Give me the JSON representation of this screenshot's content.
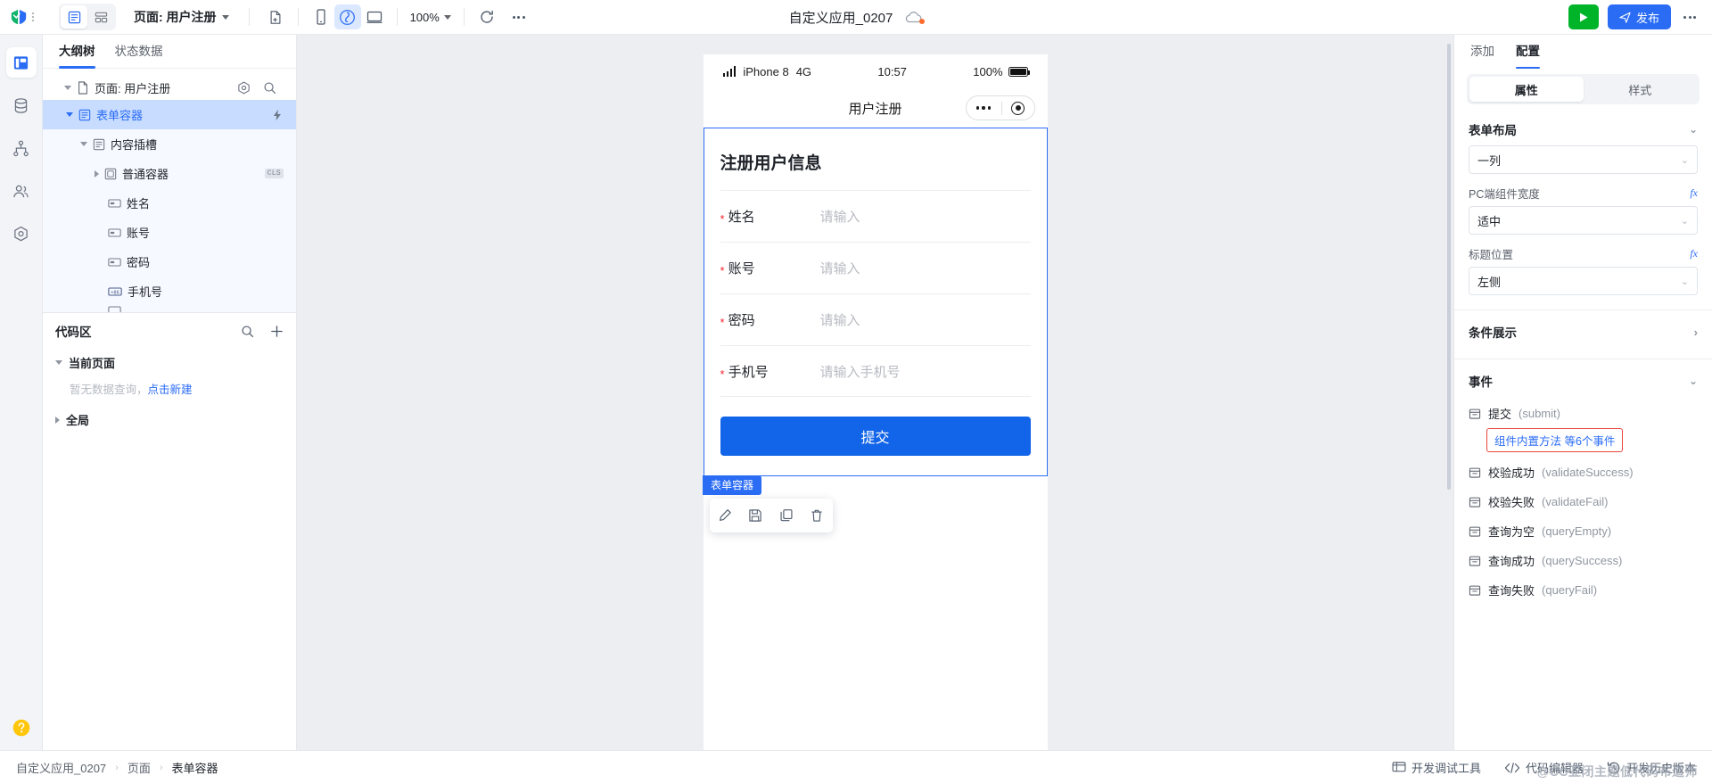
{
  "topbar": {
    "view_list_icon": "list-view-icon",
    "view_grid_icon": "grid-view-icon",
    "page_selector_label": "页面: 用户注册",
    "new_page_icon": "new-page-icon",
    "device_mobile_icon": "mobile-device-icon",
    "device_pad_icon": "pad-device-icon",
    "device_desktop_icon": "desktop-device-icon",
    "zoom_value": "100%",
    "refresh_icon": "refresh-icon",
    "more_icon": "more-horizontal-icon",
    "app_title": "自定义应用_0207",
    "cloud_icon": "cloud-sync-icon",
    "run_label": "",
    "publish_label": "发布",
    "overflow_label": ""
  },
  "rail": {
    "items": [
      {
        "name": "layout",
        "icon": "layout-panel-icon",
        "active": true
      },
      {
        "name": "data",
        "icon": "database-icon",
        "active": false
      },
      {
        "name": "flow",
        "icon": "branch-flow-icon",
        "active": false
      },
      {
        "name": "users",
        "icon": "users-icon",
        "active": false
      },
      {
        "name": "settings",
        "icon": "hexagon-settings-icon",
        "active": false
      }
    ],
    "help_icon": "help-circle-icon"
  },
  "left_panel": {
    "tabs": [
      {
        "label": "大纲树",
        "active": true
      },
      {
        "label": "状态数据",
        "active": false
      }
    ],
    "tree_root": {
      "label": "页面: 用户注册",
      "gear_icon": "gear-icon",
      "search_icon": "search-icon"
    },
    "tree_nodes": [
      {
        "label": "表单容器",
        "icon": "form-container-icon",
        "indent": 1,
        "selected": true,
        "expanded": true,
        "trailing": "bolt-icon"
      },
      {
        "label": "内容插槽",
        "icon": "slot-icon",
        "indent": 2,
        "selected": false,
        "expanded": true,
        "trailing": ""
      },
      {
        "label": "普通容器",
        "icon": "plain-container-icon",
        "indent": 3,
        "selected": false,
        "expanded": false,
        "trailing": "CLS"
      },
      {
        "label": "姓名",
        "icon": "input-field-icon",
        "indent": 3,
        "selected": false,
        "expanded": null,
        "trailing": ""
      },
      {
        "label": "账号",
        "icon": "input-field-icon",
        "indent": 3,
        "selected": false,
        "expanded": null,
        "trailing": ""
      },
      {
        "label": "密码",
        "icon": "input-field-icon",
        "indent": 3,
        "selected": false,
        "expanded": null,
        "trailing": ""
      },
      {
        "label": "手机号",
        "icon": "phone-input-icon",
        "indent": 3,
        "selected": false,
        "expanded": null,
        "trailing": ""
      }
    ],
    "code_area": {
      "title": "代码区",
      "search_icon": "search-icon",
      "add_icon": "plus-icon",
      "current_page_label": "当前页面",
      "empty_text": "暂无数据查询，",
      "empty_link": "点击新建",
      "global_label": "全局"
    }
  },
  "canvas": {
    "phone": {
      "status_bar": {
        "signal_icon": "signal-bars-icon",
        "carrier": "iPhone 8",
        "network": "4G",
        "time": "10:57",
        "battery_text": "100%",
        "battery_icon": "battery-full-icon"
      },
      "nav_title": "用户注册",
      "capsule_more_icon": "capsule-more-icon",
      "capsule_target_icon": "capsule-target-icon",
      "form": {
        "title": "注册用户信息",
        "fields": [
          {
            "label": "姓名",
            "required": true,
            "placeholder": "请输入"
          },
          {
            "label": "账号",
            "required": true,
            "placeholder": "请输入"
          },
          {
            "label": "密码",
            "required": true,
            "placeholder": "请输入"
          },
          {
            "label": "手机号",
            "required": true,
            "placeholder": "请输入手机号"
          }
        ],
        "submit_label": "提交"
      },
      "selection_tag": "表单容器",
      "selection_toolbar": [
        {
          "name": "edit",
          "icon": "pencil-icon"
        },
        {
          "name": "save",
          "icon": "save-icon"
        },
        {
          "name": "copy",
          "icon": "copy-icon"
        },
        {
          "name": "delete",
          "icon": "trash-icon"
        }
      ]
    }
  },
  "right_panel": {
    "tabs": [
      {
        "label": "添加",
        "active": false
      },
      {
        "label": "配置",
        "active": true
      }
    ],
    "segment": [
      {
        "label": "属性",
        "active": true
      },
      {
        "label": "样式",
        "active": false
      }
    ],
    "sections": [
      {
        "title": "表单布局",
        "collapsible": true,
        "expanded": true,
        "fields": [
          {
            "label": "",
            "value": "一列",
            "fx": false
          },
          {
            "label": "PC端组件宽度",
            "value": "适中",
            "fx": true
          },
          {
            "label": "标题位置",
            "value": "左侧",
            "fx": true
          }
        ]
      },
      {
        "title": "条件展示",
        "collapsible": true,
        "expanded": false,
        "fields": []
      }
    ],
    "events_section": {
      "title": "事件",
      "expanded": true,
      "events": [
        {
          "name": "提交",
          "code": "(submit)",
          "icon": "event-icon",
          "highlighted_sub": "组件内置方法 等6个事件"
        },
        {
          "name": "校验成功",
          "code": "(validateSuccess)",
          "icon": "event-icon",
          "highlighted_sub": ""
        },
        {
          "name": "校验失败",
          "code": "(validateFail)",
          "icon": "event-icon",
          "highlighted_sub": ""
        },
        {
          "name": "查询为空",
          "code": "(queryEmpty)",
          "icon": "event-icon",
          "highlighted_sub": ""
        },
        {
          "name": "查询成功",
          "code": "(querySuccess)",
          "icon": "event-icon",
          "highlighted_sub": ""
        },
        {
          "name": "查询失败",
          "code": "(queryFail)",
          "icon": "event-icon",
          "highlighted_sub": ""
        }
      ]
    }
  },
  "footer": {
    "breadcrumb": [
      "自定义应用_0207",
      "页面",
      "表单容器"
    ],
    "actions": [
      {
        "label": "开发调试工具",
        "icon": "debug-tool-icon"
      },
      {
        "label": "代码编辑器",
        "icon": "code-editor-icon"
      },
      {
        "label": "开发历史版本",
        "icon": "history-icon"
      }
    ],
    "watermark": "@CC亚闭主题低代码布道师"
  },
  "colors": {
    "accent": "#2b6cf5",
    "submit": "#1264e8",
    "run_green": "#00b42a",
    "required_red": "#f5222d",
    "highlight_border": "#e8453c",
    "selected_row": "#c7dcff"
  }
}
